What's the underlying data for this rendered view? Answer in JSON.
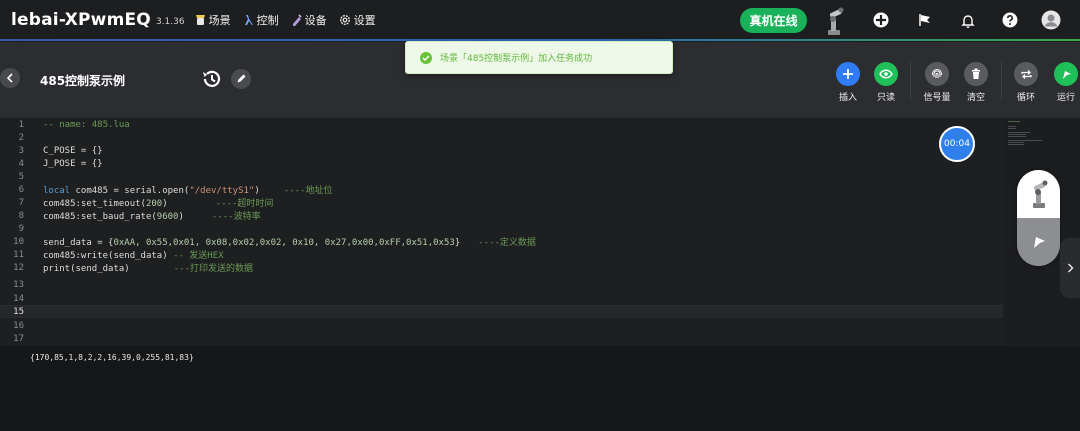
{
  "header": {
    "brand": "lebai-XPwmEQ",
    "version": "3.1.36",
    "nav": [
      {
        "label": "场景",
        "icon": "scene-icon"
      },
      {
        "label": "控制",
        "icon": "control-icon"
      },
      {
        "label": "设备",
        "icon": "device-icon"
      },
      {
        "label": "设置",
        "icon": "gear-icon"
      }
    ],
    "online_label": "真机在线"
  },
  "toast": {
    "message": "场景「485控制泵示例」加入任务成功"
  },
  "page": {
    "title": "485控制泵示例"
  },
  "toolbar": [
    {
      "label": "插入",
      "color": "#2f7cf6",
      "icon": "plus-icon"
    },
    {
      "label": "只读",
      "color": "#1fbf5a",
      "icon": "eye-icon"
    },
    {
      "label": "信号量",
      "color": "#5a5b5f",
      "icon": "fingerprint-icon"
    },
    {
      "label": "清空",
      "color": "#5a5b5f",
      "icon": "trash-icon"
    },
    {
      "label": "循环",
      "color": "#5a5b5f",
      "icon": "loop-icon"
    },
    {
      "label": "运行",
      "color": "#1fbf5a",
      "icon": "run-icon"
    }
  ],
  "editor": {
    "line_numbers": [
      "1",
      "2",
      "3",
      "4",
      "5",
      "6",
      "7",
      "8",
      "9",
      "10",
      "11",
      "12",
      "13",
      "14",
      "15",
      "16",
      "17"
    ],
    "lines": {
      "l1": "-- name: 485.lua",
      "l3": "C_POSE = {}",
      "l4": "J_POSE = {}",
      "l6a": "local",
      "l6b": " com485 = serial.open(",
      "l6c": "\"/dev/ttyS1\"",
      "l6d": ")",
      "l6e": "----地址位",
      "l7a": "com485:set_timeout(",
      "l7b": "200",
      "l7c": ")",
      "l7d": "----超时时间",
      "l8a": "com485:set_baud_rate(",
      "l8b": "9600",
      "l8c": ")",
      "l8d": "----波特率",
      "l10a": "send_data = {",
      "l10b": "0xAA, 0x55,0x01, 0x08,0x02,0x02, 0x10, 0x27,0x00,0xFF,0x51,0x53",
      "l10c": "}",
      "l10d": "----定义数据",
      "l11a": "com485:write(send_data) ",
      "l11b": "-- 发送HEX",
      "l12a": "print(send_data)",
      "l12b": "---打印发送的数据"
    }
  },
  "timer": "00:04",
  "output": "{170,85,1,8,2,2,16,39,0,255,81,83}"
}
